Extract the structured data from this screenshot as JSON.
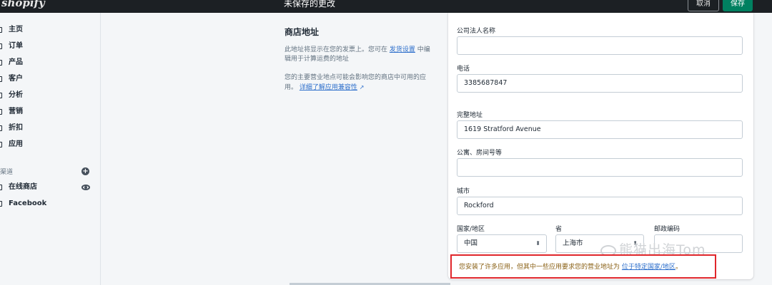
{
  "header": {
    "brand": "shopify",
    "status": "未保存的更改",
    "cancel_label": "取消",
    "save_label": "保存"
  },
  "sidebar": {
    "items": [
      {
        "label": "主页",
        "icon": "home-icon"
      },
      {
        "label": "订单",
        "icon": "orders-icon"
      },
      {
        "label": "产品",
        "icon": "products-icon"
      },
      {
        "label": "客户",
        "icon": "customers-icon"
      },
      {
        "label": "分析",
        "icon": "analytics-icon"
      },
      {
        "label": "营销",
        "icon": "marketing-icon"
      },
      {
        "label": "折扣",
        "icon": "discounts-icon"
      },
      {
        "label": "应用",
        "icon": "apps-icon"
      }
    ],
    "channels_title": "渠道",
    "channels": [
      {
        "label": "在线商店",
        "icon": "online-store-icon"
      },
      {
        "label": "Facebook",
        "icon": "facebook-icon"
      }
    ]
  },
  "section": {
    "title": "商店地址",
    "desc1_pre": "此地址将显示在您的发票上。您可在",
    "desc1_link": "发货设置",
    "desc1_post": "中编辑用于计算运费的地址",
    "desc2_pre": "您的主要营业地点可能会影响您的商店中可用的应用。",
    "desc2_link": "详细了解应用兼容性"
  },
  "form": {
    "legal_name_label": "公司法人名称",
    "legal_name_value": "",
    "phone_label": "电话",
    "phone_value": "3385687847",
    "address_label": "完整地址",
    "address_value": "1619 Stratford Avenue",
    "apt_label": "公寓、房间号等",
    "apt_value": "",
    "city_label": "城市",
    "city_value": "Rockford",
    "country_label": "国家/地区",
    "country_value": "中国",
    "province_label": "省",
    "province_value": "上海市",
    "postal_label": "邮政编码",
    "postal_value": ""
  },
  "warning": {
    "text": "您安装了许多应用，但其中一些应用要求您的营业地址为",
    "link": "位于特定国家/地区",
    "end": "。"
  },
  "watermark": "熊猫出海Tom",
  "colors": {
    "accent": "#008060",
    "link": "#2c6ecb",
    "alert_border": "#e0262b"
  }
}
